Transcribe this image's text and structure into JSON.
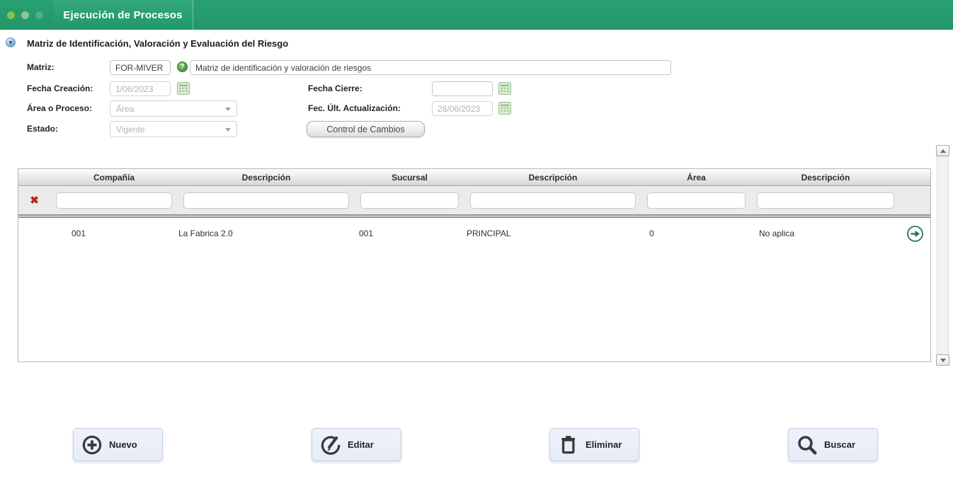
{
  "colors": {
    "header_green": "#21966A",
    "row_arrow_green": "#2E7257",
    "button_bg": "#E9EEF8",
    "button_border": "#C7D1E2",
    "red_x": "#B42B22",
    "calendar_icon_green": "#DDEED8"
  },
  "window": {
    "tab_title": "Ejecución de Procesos"
  },
  "page": {
    "title": "Matriz de Identificación, Valoración y Evaluación del Riesgo"
  },
  "form": {
    "matriz": {
      "label": "Matriz:",
      "code": "FOR-MIVER",
      "description": "Matriz de identificación y valoración de riesgos"
    },
    "fecha_creacion": {
      "label": "Fecha Creación:",
      "value": "1/06/2023"
    },
    "area_o_proceso": {
      "label": "Área o Proceso:",
      "value": "Área"
    },
    "estado": {
      "label": "Estado:",
      "value": "Vigente"
    },
    "fecha_cierre": {
      "label": "Fecha Cierre:",
      "value": ""
    },
    "fec_ult_actualizacion": {
      "label": "Fec. Últ. Actualización:",
      "value": "28/06/2023"
    },
    "control_de_cambios": {
      "label": "Control de Cambios"
    }
  },
  "table": {
    "columns": [
      "Compañía",
      "Descripción",
      "Sucursal",
      "Descripción",
      "Área",
      "Descripción"
    ],
    "rows": [
      {
        "cells": [
          "001",
          "La Fabrica 2.0",
          "001",
          "PRINCIPAL",
          "0",
          "No aplica"
        ]
      }
    ]
  },
  "actions": [
    {
      "label": "Nuevo"
    },
    {
      "label": "Editar"
    },
    {
      "label": "Eliminar"
    },
    {
      "label": "Buscar"
    }
  ],
  "icons": {
    "help": "?",
    "clear_filter": "✖"
  }
}
